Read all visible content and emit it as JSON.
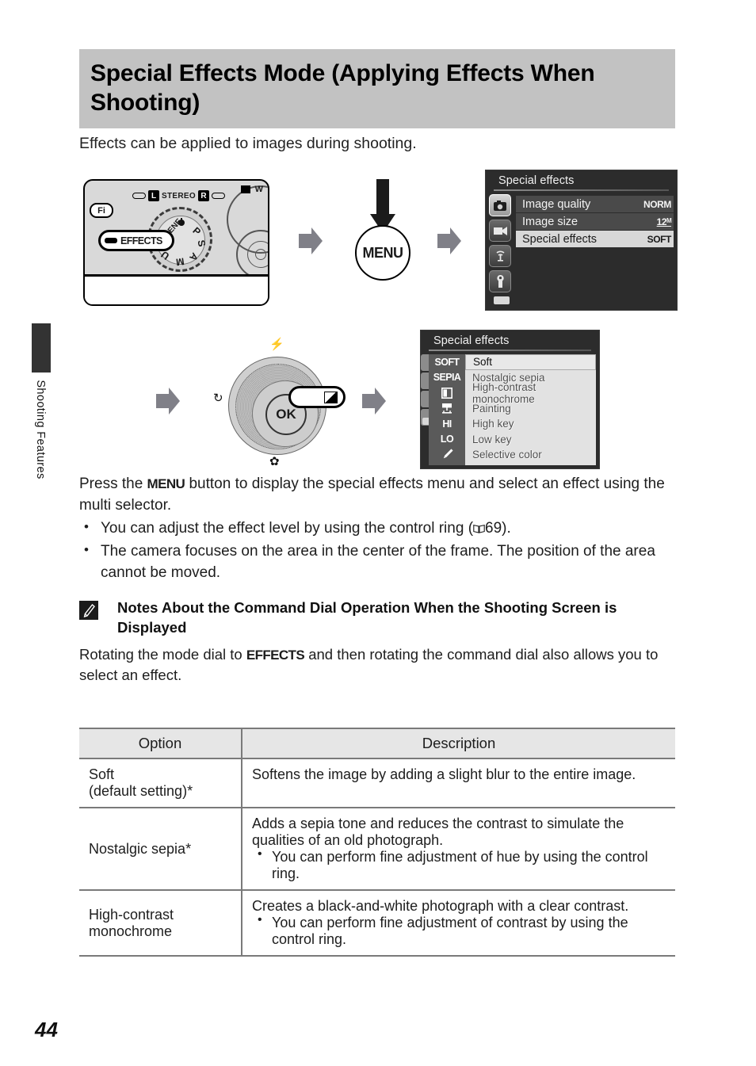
{
  "side_tab": {
    "label": "Shooting Features"
  },
  "header": {
    "title": "Special Effects Mode (Applying Effects When Shooting)"
  },
  "intro": "Effects can be applied to images during shooting.",
  "figure_row_1": {
    "camera": {
      "fi_label": "Fi",
      "stereo_left": "L",
      "stereo_text": "STEREO",
      "stereo_right": "R",
      "w_label": "W",
      "dial_callout": "EFFECTS",
      "dial_letters": [
        "SCENE",
        "P",
        "S",
        "A",
        "M",
        "U"
      ]
    },
    "menu_button": {
      "label": "MENU",
      "arrow": "down-arrow"
    },
    "lcd_menu": {
      "title": "Special effects",
      "side_icons": [
        "camera-icon",
        "movie-icon",
        "wifi-icon",
        "wrench-icon"
      ],
      "rows": [
        {
          "label": "Image quality",
          "value": "NORM",
          "selected": false
        },
        {
          "label": "Image size",
          "value": "12ᴹ",
          "selected": false
        },
        {
          "label": "Special effects",
          "value": "SOFT",
          "selected": true
        }
      ],
      "battery": "battery-icon"
    }
  },
  "figure_row_2": {
    "multi_selector": {
      "center_label": "OK",
      "top_mark": "flash-icon",
      "left_mark": "self-timer-icon",
      "bottom_mark": "macro-icon",
      "right_callout": "exposure-compensation-icon"
    },
    "lcd_effects": {
      "title": "Special effects",
      "items": [
        {
          "icon": "SOFT",
          "label": "Soft",
          "selected": true
        },
        {
          "icon": "SEPIA",
          "label": "Nostalgic sepia",
          "selected": false
        },
        {
          "icon": "◧",
          "label": "High-contrast monochrome",
          "selected": false
        },
        {
          "icon": "☂",
          "label": "Painting",
          "selected": false
        },
        {
          "icon": "HI",
          "label": "High key",
          "selected": false
        },
        {
          "icon": "LO",
          "label": "Low key",
          "selected": false
        },
        {
          "icon": "✒",
          "label": "Selective color",
          "selected": false
        }
      ]
    }
  },
  "body": {
    "lead_pre": "Press the ",
    "lead_glyph": "MENU",
    "lead_post": " button to display the special effects menu and select an effect using the multi selector.",
    "bullets": [
      {
        "pre": "You can adjust the effect level by using the control ring (",
        "ref": "69",
        "post": ")."
      },
      {
        "pre": "The camera focuses on the area in the center of the frame. The position of the area cannot be moved.",
        "ref": "",
        "post": ""
      }
    ]
  },
  "note": {
    "icon": "pencil-icon",
    "title": "Notes About the Command Dial Operation When the Shooting Screen is Displayed",
    "body_pre": "Rotating the mode dial to ",
    "body_glyph": "EFFECTS",
    "body_post": " and then rotating the command dial also allows you to select an effect."
  },
  "table": {
    "headers": [
      "Option",
      "Description"
    ],
    "rows": [
      {
        "option": "Soft\n(default setting)*",
        "desc_lead": "Softens the image by adding a slight blur to the entire image.",
        "desc_bullets": []
      },
      {
        "option": "Nostalgic sepia*",
        "desc_lead": "Adds a sepia tone and reduces the contrast to simulate the qualities of an old photograph.",
        "desc_bullets": [
          "You can perform fine adjustment of hue by using the control ring."
        ]
      },
      {
        "option": "High-contrast monochrome",
        "desc_lead": "Creates a black-and-white photograph with a clear contrast.",
        "desc_bullets": [
          "You can perform fine adjustment of contrast by using the control ring."
        ]
      }
    ]
  },
  "page_number": "44",
  "colors": {
    "header_bg": "#c2c2c2",
    "arrow_gray": "#808088",
    "table_header_bg": "#e6e6e6",
    "rule": "#7a7a7a"
  }
}
